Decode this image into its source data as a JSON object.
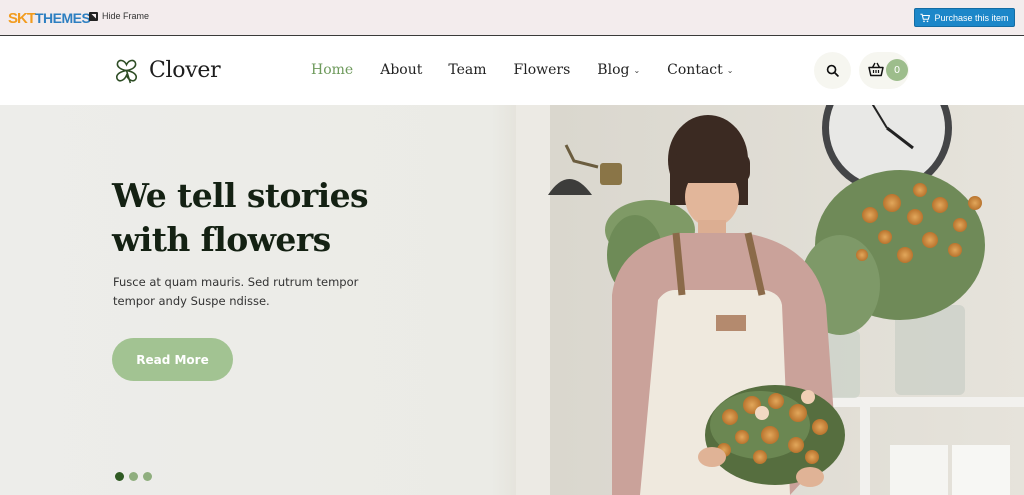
{
  "frame": {
    "brand_skt": "SKT",
    "brand_themes": "THEMES",
    "hide_frame_label": "Hide Frame",
    "purchase_label": "Purchase this item"
  },
  "header": {
    "logo_text": "Clover",
    "nav": [
      {
        "label": "Home",
        "active": true
      },
      {
        "label": "About"
      },
      {
        "label": "Team"
      },
      {
        "label": "Flowers"
      },
      {
        "label": "Blog",
        "dropdown": true
      },
      {
        "label": "Contact",
        "dropdown": true
      }
    ],
    "cart_count": "0",
    "icons": {
      "search": "search-icon",
      "cart": "basket-icon",
      "logo": "clover-leaf-icon"
    }
  },
  "hero": {
    "title_line1": "We tell stories",
    "title_line2": "with flowers",
    "text": "Fusce at quam mauris. Sed rutrum tempor tempor andy Suspe ndisse.",
    "button_label": "Read More",
    "slides": 3,
    "active_slide": 1,
    "colors": {
      "accent": "#a2c392",
      "active_nav": "#6e9a5c",
      "title": "#142113"
    }
  }
}
